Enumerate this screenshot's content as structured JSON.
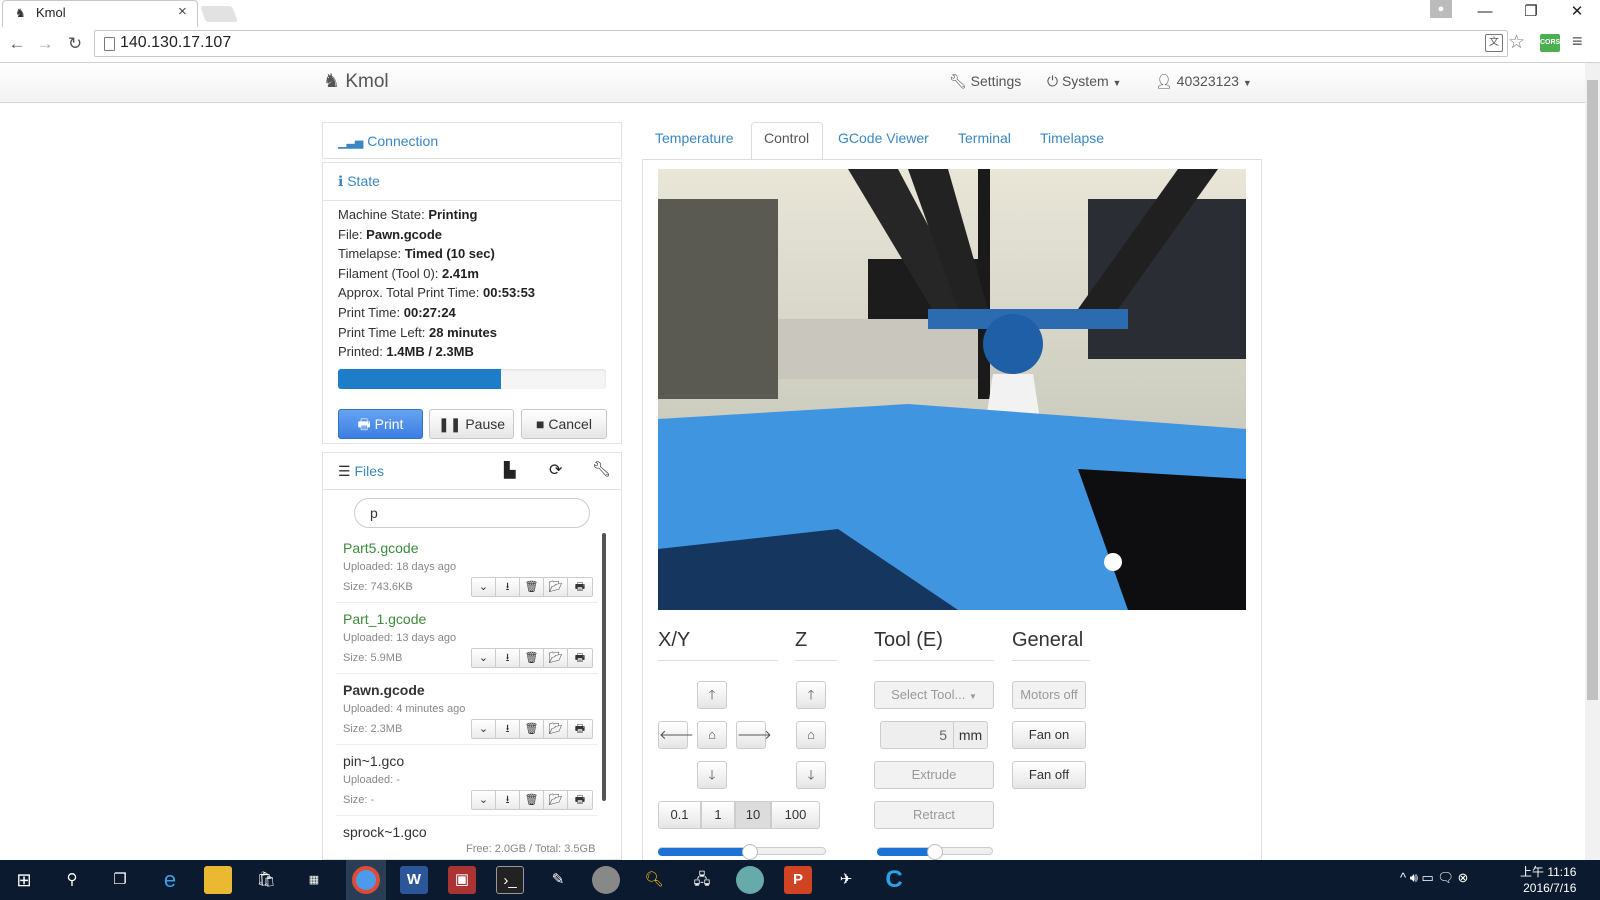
{
  "browser": {
    "tab_title": "Kmol",
    "url": "140.130.17.107",
    "ext": "CORS"
  },
  "nav": {
    "brand": "Kmol",
    "settings": "Settings",
    "system": "System",
    "user": "40323123"
  },
  "connection": {
    "title": "Connection"
  },
  "state": {
    "title": "State",
    "rows": [
      {
        "label": "Machine State: ",
        "value": "Printing"
      },
      {
        "label": "File: ",
        "value": "Pawn.gcode"
      },
      {
        "label": "Timelapse: ",
        "value": "Timed (10 sec)"
      },
      {
        "label": "Filament (Tool 0): ",
        "value": "2.41m"
      },
      {
        "label": "Approx. Total Print Time: ",
        "value": "00:53:53"
      },
      {
        "label": "Print Time: ",
        "value": "00:27:24"
      },
      {
        "label": "Print Time Left: ",
        "value": "28 minutes"
      },
      {
        "label": "Printed: ",
        "value": "1.4MB / 2.3MB"
      }
    ],
    "progress": 0.61,
    "print_btn": "Print",
    "pause_btn": "Pause",
    "cancel_btn": "Cancel"
  },
  "files": {
    "title": "Files",
    "search": "p",
    "items": [
      {
        "name": "Part5.gcode",
        "uploaded": "Uploaded: 18 days ago",
        "size": "Size: 743.6KB",
        "color": "#3d8b3d",
        "bold": false
      },
      {
        "name": "Part_1.gcode",
        "uploaded": "Uploaded: 13 days ago",
        "size": "Size: 5.9MB",
        "color": "#3d8b3d",
        "bold": false
      },
      {
        "name": "Pawn.gcode",
        "uploaded": "Uploaded: 4 minutes ago",
        "size": "Size: 2.3MB",
        "color": "#333",
        "bold": true
      },
      {
        "name": "pin~1.gco",
        "uploaded": "Uploaded: -",
        "size": "Size: -",
        "color": "#333",
        "bold": false
      },
      {
        "name": "sprock~1.gco",
        "uploaded": "",
        "size": "",
        "color": "#333",
        "bold": false
      }
    ],
    "free": "Free: 2.0GB / Total: 3.5GB"
  },
  "tabs": [
    "Temperature",
    "Control",
    "GCode Viewer",
    "Terminal",
    "Timelapse"
  ],
  "control": {
    "xy": "X/Y",
    "z": "Z",
    "tool": "Tool (E)",
    "general": "General",
    "steps": [
      "0.1",
      "1",
      "10",
      "100"
    ],
    "select_tool": "Select Tool...",
    "amount": "5",
    "unit": "mm",
    "extrude": "Extrude",
    "retract": "Retract",
    "motors_off": "Motors off",
    "fan_on": "Fan on",
    "fan_off": "Fan off",
    "feed_slider": 0.55,
    "flow_slider": 0.5
  },
  "taskbar": {
    "time": "上午 11:16",
    "date": "2016/7/16"
  }
}
